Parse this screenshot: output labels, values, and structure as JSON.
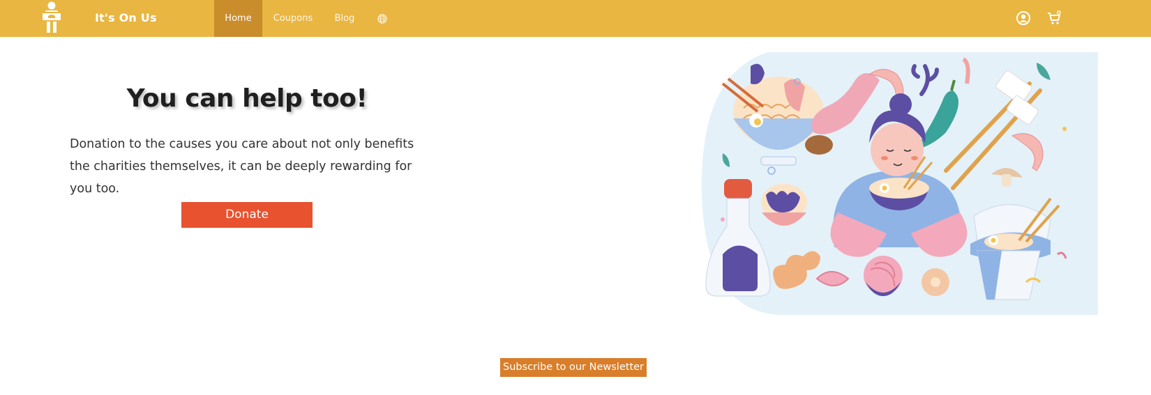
{
  "navbar": {
    "brand": "It's On Us",
    "logo_icon": "person-holding-box-icon",
    "links": [
      {
        "label": "Home",
        "active": true
      },
      {
        "label": "Coupons",
        "active": false
      },
      {
        "label": "Blog",
        "active": false
      }
    ],
    "language_icon": "globe-icon",
    "account_icon": "user-circle-icon",
    "cart_icon": "shopping-cart-icon",
    "background_color": "#e9b641",
    "active_color": "#c98d2c"
  },
  "hero": {
    "title": "You can help too!",
    "text": "Donation to the causes you care about not only benefits the charities themselves, it can be deeply rewarding for you too.",
    "donate_label": "Donate",
    "donate_color": "#e8522f",
    "illustration": "food-illustration"
  },
  "newsletter": {
    "label": "Subscribe to our Newsletter",
    "color": "#d97e2a"
  }
}
